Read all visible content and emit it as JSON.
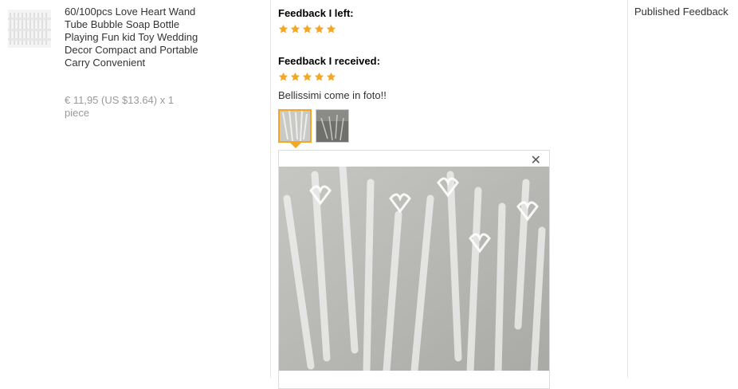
{
  "product": {
    "title": "60/100pcs Love Heart Wand Tube Bubble Soap Bottle Playing Fun kid Toy Wedding Decor Compact and Portable Carry Convenient",
    "price": "€ 11,95 (US $13.64) x 1 piece"
  },
  "feedback": {
    "left_heading": "Feedback I left:",
    "left_rating": 5,
    "received_heading": "Feedback I received:",
    "received_rating": 5,
    "comment": "Bellissimi come in foto!!",
    "close_symbol": "✕"
  },
  "status": {
    "label": "Published Feedback"
  },
  "colors": {
    "star": "#f5a623",
    "divider": "#e8e8e8",
    "selected_border": "#f5a623"
  }
}
